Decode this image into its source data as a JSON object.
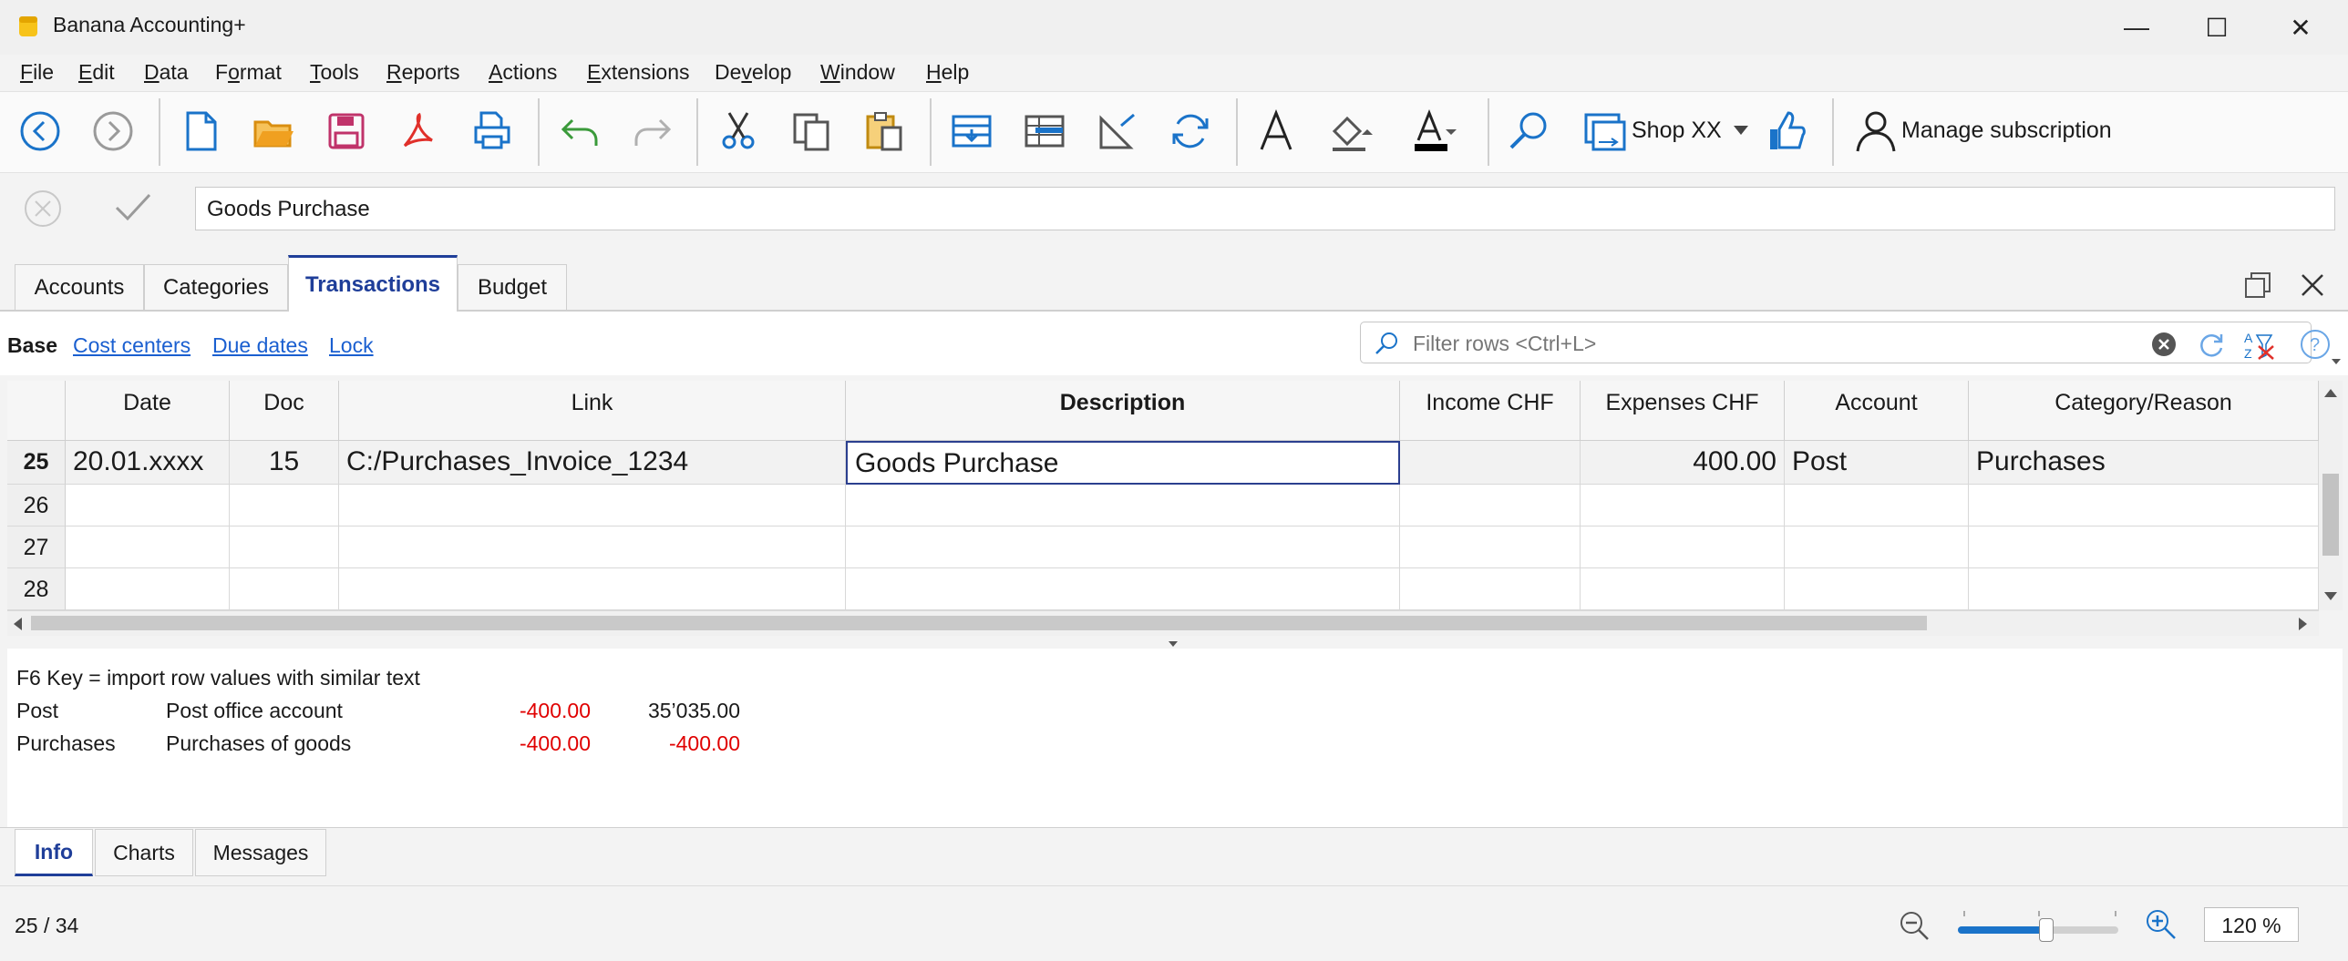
{
  "window": {
    "title": "Banana Accounting+",
    "minimize_glyph": "—",
    "maximize_glyph": "☐",
    "close_glyph": "✕"
  },
  "menu": [
    {
      "pre": "",
      "u": "F",
      "post": "ile"
    },
    {
      "pre": "",
      "u": "E",
      "post": "dit"
    },
    {
      "pre": "",
      "u": "D",
      "post": "ata"
    },
    {
      "pre": "F",
      "u": "o",
      "post": "rmat"
    },
    {
      "pre": "",
      "u": "T",
      "post": "ools"
    },
    {
      "pre": "",
      "u": "R",
      "post": "eports"
    },
    {
      "pre": "",
      "u": "A",
      "post": "ctions"
    },
    {
      "pre": "",
      "u": "E",
      "post": "xtensions"
    },
    {
      "pre": "De",
      "u": "v",
      "post": "elop"
    },
    {
      "pre": "",
      "u": "W",
      "post": "indow"
    },
    {
      "pre": "",
      "u": "H",
      "post": "elp"
    }
  ],
  "toolbar": {
    "icons": [
      "back-icon",
      "forward-icon",
      "new-file-icon",
      "open-folder-icon",
      "save-icon",
      "pdf-icon",
      "print-icon",
      "undo-icon",
      "redo-icon",
      "cut-icon",
      "copy-icon",
      "paste-icon",
      "insert-rows-icon",
      "add-row-icon",
      "settings-triangle-icon",
      "refresh-icon",
      "font-icon",
      "fill-color-icon",
      "text-color-icon",
      "search-icon",
      "shop-icon",
      "like-icon",
      "user-icon"
    ],
    "shop_label": "Shop XX",
    "subscription_label": "Manage subscription",
    "accent": "#1a73c9",
    "folder_color": "#f0a020",
    "save_color": "#c0336a",
    "pdf_color": "#e0302a",
    "undo_color": "#3a9a3a"
  },
  "edit_bar": {
    "value": "Goods Purchase"
  },
  "tabs": [
    "Accounts",
    "Categories",
    "Transactions",
    "Budget"
  ],
  "active_tab": "Transactions",
  "views": {
    "base": "Base",
    "links": [
      "Cost centers",
      "Due dates",
      "Lock"
    ]
  },
  "filter": {
    "placeholder": "Filter rows <Ctrl+L>"
  },
  "table": {
    "columns": [
      "Date",
      "Doc",
      "Link",
      "Description",
      "Income CHF",
      "Expenses CHF",
      "Account",
      "Category/Reason"
    ],
    "rows": [
      {
        "num": "25",
        "date": "20.01.xxxx",
        "doc": "15",
        "link": "C:/Purchases_Invoice_1234",
        "description": "Goods Purchase",
        "income": "",
        "expenses": "400.00",
        "account": "Post",
        "category": "Purchases"
      },
      {
        "num": "26",
        "date": "",
        "doc": "",
        "link": "",
        "description": "",
        "income": "",
        "expenses": "",
        "account": "",
        "category": ""
      },
      {
        "num": "27",
        "date": "",
        "doc": "",
        "link": "",
        "description": "",
        "income": "",
        "expenses": "",
        "account": "",
        "category": ""
      },
      {
        "num": "28",
        "date": "",
        "doc": "",
        "link": "",
        "description": "",
        "income": "",
        "expenses": "",
        "account": "",
        "category": ""
      }
    ]
  },
  "info": {
    "hint": "F6 Key = import row values with similar text",
    "lines": [
      {
        "code": "Post",
        "name": "Post office account",
        "amount": "-400.00",
        "balance": "35’035.00",
        "balance_negative": false
      },
      {
        "code": "Purchases",
        "name": "Purchases of goods",
        "amount": "-400.00",
        "balance": "-400.00",
        "balance_negative": true
      }
    ]
  },
  "bottom_tabs": [
    "Info",
    "Charts",
    "Messages"
  ],
  "status": {
    "position": "25 / 34",
    "zoom": "120 %",
    "zoom_level_fraction": 0.55
  }
}
